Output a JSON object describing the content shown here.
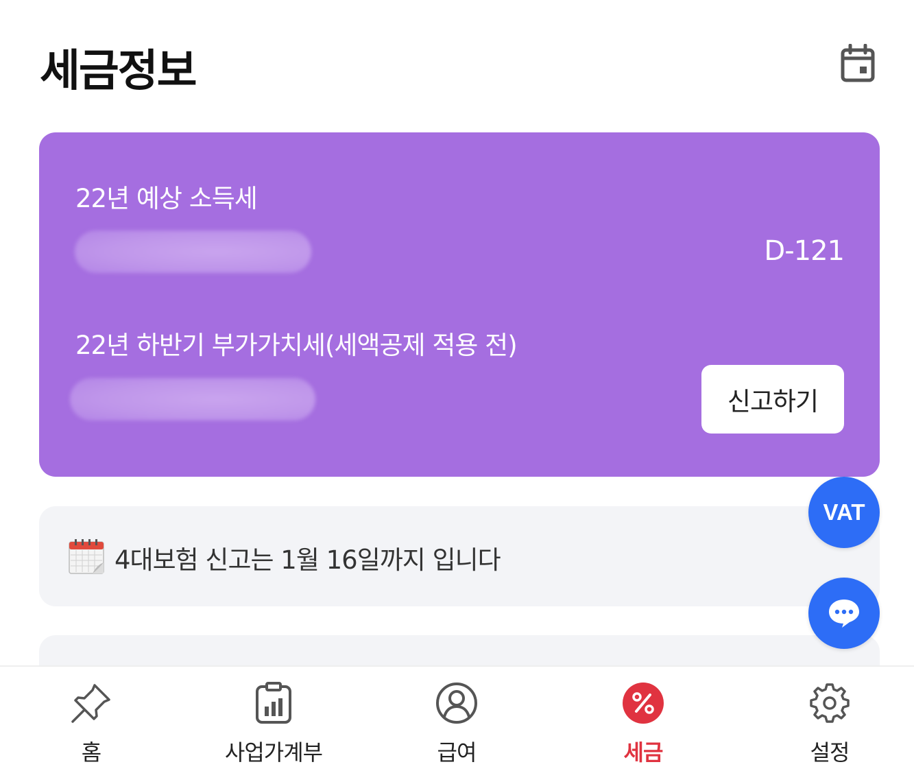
{
  "header": {
    "title": "세금정보",
    "calendar_icon": "calendar-icon"
  },
  "tax_card": {
    "background_color": "#a56ee0",
    "income_tax_label": "22년 예상 소득세",
    "vat_label": "22년 하반기 부가가치세(세액공제 적용 전)",
    "dday": "D-121",
    "report_button_label": "신고하기"
  },
  "notice": {
    "icon": "calendar-page-icon",
    "text": "4대보험 신고는 1월 16일까지 입니다"
  },
  "fabs": {
    "vat_label": "VAT",
    "chat_icon": "chat-bubble-icon",
    "color": "#2d6df6"
  },
  "bottom_nav": {
    "items": [
      {
        "label": "홈",
        "icon": "pushpin-icon"
      },
      {
        "label": "사업가계부",
        "icon": "clipboard-chart-icon"
      },
      {
        "label": "급여",
        "icon": "user-circle-icon"
      },
      {
        "label": "세금",
        "icon": "percent-icon",
        "active": true
      },
      {
        "label": "설정",
        "icon": "gear-icon"
      }
    ],
    "active_color": "#e03340"
  }
}
